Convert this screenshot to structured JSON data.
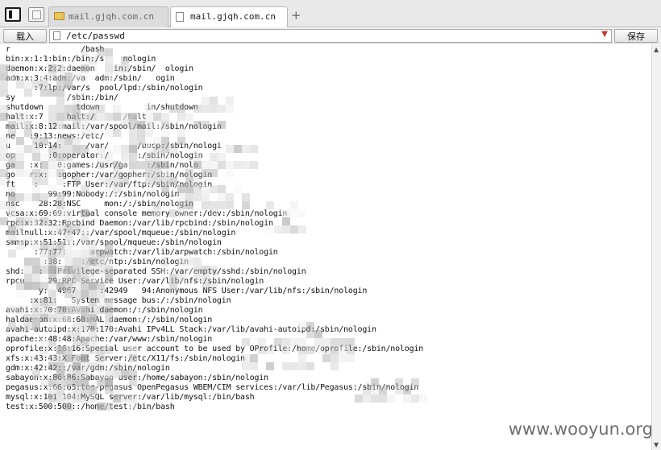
{
  "tabs": [
    {
      "label": "mail.gjqh.com.cn",
      "icon": "folder-icon",
      "active": false
    },
    {
      "label": "mail.gjqh.com.cn",
      "icon": "page-icon",
      "active": true
    }
  ],
  "new_tab_label": "+",
  "toolbar": {
    "load_label": "载入",
    "save_label": "保存"
  },
  "address": {
    "value": "/etc/passwd"
  },
  "file_lines": [
    "r               /bash",
    "bin:x:1:1:bin:/bin:/s    nologin",
    "daemon:x:2:2:daemon    in:/sbin/  ologin",
    "adm:x:3:4:adm:/va  adm:/sbin/   ogin",
    "      :7:lp:/var/s  pool/lpd:/sbin/nologin",
    "sy           /sbin:/bin/",
    "shutdown       tdown          in/shutdown",
    "halt:x:7     halt:/      /halt",
    "mail:x:8:12:mail:/var/spool/mail:/sbin/nologin",
    "ne   :9:13:news:/etc/",
    "u     10:14:     /var/      /uucp:/sbin/nologi",
    "op       :0:operator:/      :/sbin/nologin",
    "ga   :x:   0:games:/usr/ga    :/sbin/nolo",
    "go   r:x:  :gopher:/var/gopher:/sbin/nologin",
    "ft    :     :FTP User:/var/ftp:/sbin/nologin",
    "no       99:99:Nobody:/:/sbin/nologin",
    "nsc    28:28:NSC     mon:/:/sbin/nologin",
    "vcsa:x:69:69:virtual console memory owner:/dev:/sbin/nologin",
    "rpc:x:32:32:Rpcbind Daemon:/var/lib/rpcbind:/sbin/nologin",
    "mailnull:x:47:47::/var/spool/mqueue:/sbin/nologin",
    "smmsp:x:51:51::/var/spool/mqueue:/sbin/nologin",
    "      :77:77:     arpwatch:/var/lib/arpwatch:/sbin/nologin",
    "        :38:    :/etc/ntp:/sbin/nologin",
    "shd:   :  :Privilege-separated SSH:/var/empty/sshd:/sbin/nologin",
    "rpcu     29:RPC Service User:/var/lib/nfs:/sbin/nologin",
    "       y:  4967     :42949   94:Anonymous NFS User:/var/lib/nfs:/sbin/nologin",
    "     :x:81:   System message bus:/:/sbin/nologin",
    "avahi:x:70:70:Avahi daemon:/:/sbin/nologin",
    "haldaemon:x:68:68:HAL daemon:/:/sbin/nologin",
    "avahi-autoipd:x:170:170:Avahi IPv4LL Stack:/var/lib/avahi-autoipd:/sbin/nologin",
    "apache:x:48:48:Apache:/var/www:/sbin/nologin",
    "oprofile:x:16:16:Special user account to be used by OProfile:/home/oprofile:/sbin/nologin",
    "xfs:x:43:43:X Font Server:/etc/X11/fs:/sbin/nologin",
    "gdm:x:42:42::/var/gdm:/sbin/nologin",
    "sabayon:x:86:86:Sabayon user:/home/sabayon:/sbin/nologin",
    "pegasus:x:66:65:tog-pegasus OpenPegasus WBEM/CIM services:/var/lib/Pegasus:/sbin/nologin",
    "mysql:x:101:104:MySQL server:/var/lib/mysql:/bin/bash",
    "test:x:500:500::/home/test:/bin/bash"
  ],
  "watermark": "www.wooyun.org"
}
